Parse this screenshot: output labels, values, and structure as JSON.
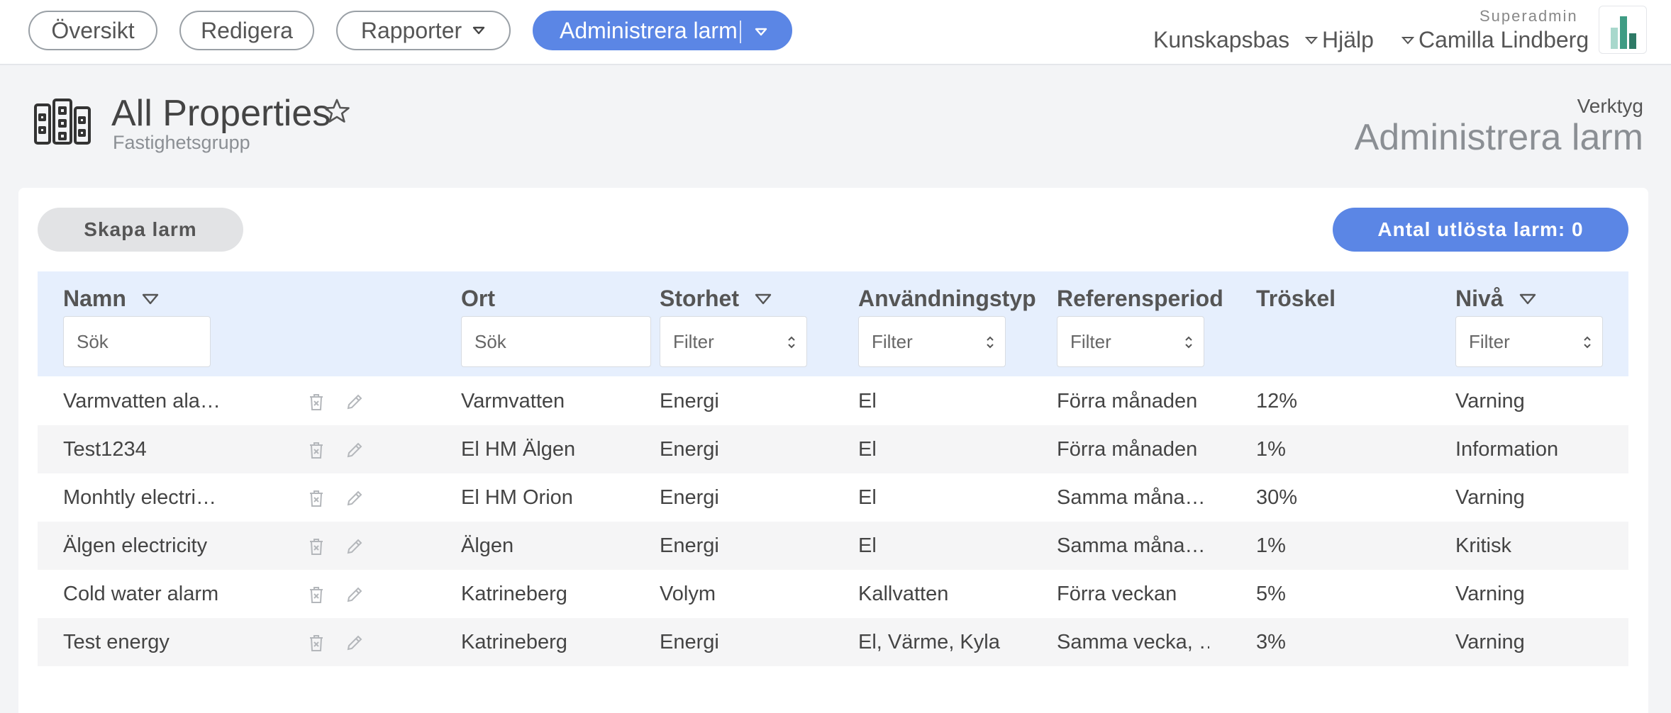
{
  "topnav": {
    "tabs": [
      {
        "label": "Översikt"
      },
      {
        "label": "Redigera"
      },
      {
        "label": "Rapporter"
      }
    ],
    "primary_label": "Administrera larm",
    "knowledge_base": "Kunskapsbas",
    "help": "Hjälp",
    "role": "Superadmin",
    "user": "Camilla Lindberg"
  },
  "header": {
    "title": "All Properties",
    "subtitle": "Fastighetsgrupp",
    "tools_label": "Verktyg",
    "tools_title": "Administrera larm"
  },
  "actions": {
    "create_label": "Skapa larm",
    "count_label": "Antal utlösta larm: 0"
  },
  "table": {
    "columns": {
      "name": "Namn",
      "location": "Ort",
      "quantity": "Storhet",
      "usage_type": "Användningstyp",
      "reference_period": "Referensperiod",
      "threshold": "Tröskel",
      "level": "Nivå"
    },
    "search_placeholder": "Sök",
    "filter_placeholder": "Filter",
    "rows": [
      {
        "name": "Varmvatten ala…",
        "location": "Varmvatten",
        "quantity": "Energi",
        "usage_type": "El",
        "reference_period": "Förra månaden",
        "threshold": "12%",
        "level": "Varning"
      },
      {
        "name": "Test1234",
        "location": "El HM Älgen",
        "quantity": "Energi",
        "usage_type": "El",
        "reference_period": "Förra månaden",
        "threshold": "1%",
        "level": "Information"
      },
      {
        "name": "Monhtly electri…",
        "location": "El HM Orion",
        "quantity": "Energi",
        "usage_type": "El",
        "reference_period": "Samma måna…",
        "threshold": "30%",
        "level": "Varning"
      },
      {
        "name": "Älgen electricity",
        "location": "Älgen",
        "quantity": "Energi",
        "usage_type": "El",
        "reference_period": "Samma måna…",
        "threshold": "1%",
        "level": "Kritisk"
      },
      {
        "name": "Cold water alarm",
        "location": "Katrineberg",
        "quantity": "Volym",
        "usage_type": "Kallvatten",
        "reference_period": "Förra veckan",
        "threshold": "5%",
        "level": "Varning"
      },
      {
        "name": "Test energy",
        "location": "Katrineberg",
        "quantity": "Energi",
        "usage_type": "El, Värme, Kyla",
        "reference_period": "Samma vecka, …",
        "threshold": "3%",
        "level": "Varning"
      }
    ]
  },
  "colors": {
    "primary": "#5b86e5",
    "header_bg": "#e6effd",
    "page_bg": "#f3f4f6"
  },
  "icons": {
    "property": "building-icon",
    "favorite": "star-icon",
    "delete": "trash-icon",
    "edit": "pencil-icon",
    "app": "bar-chart-logo-icon"
  }
}
